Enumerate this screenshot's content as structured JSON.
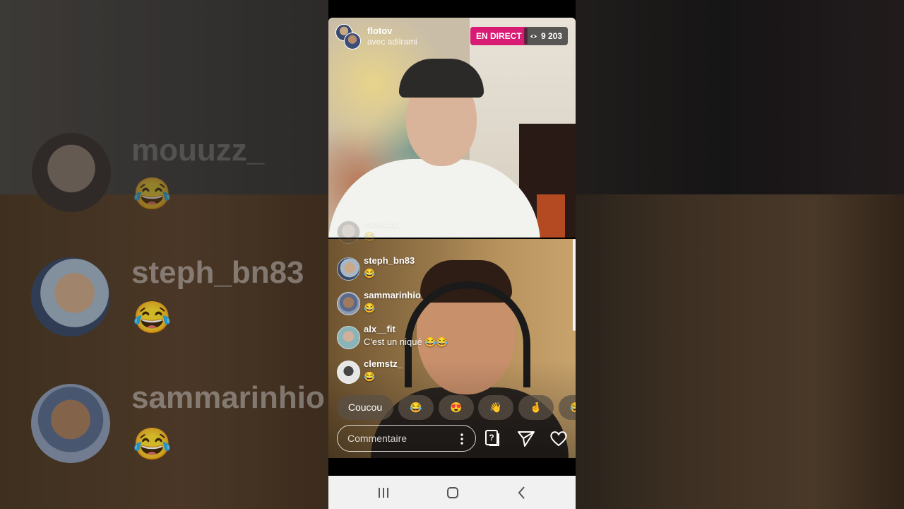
{
  "background": {
    "names": [
      "mouuzz_",
      "steph_bn83",
      "sammarinhio"
    ],
    "emojis": [
      "😂",
      "😂",
      "😂"
    ]
  },
  "live": {
    "host": "flotov",
    "with": "avec adilrami",
    "badge": "EN DIRECT",
    "viewers": "9 203"
  },
  "comments": [
    {
      "user": "mouuzz_",
      "text": "😂"
    },
    {
      "user": "steph_bn83",
      "text": "😂"
    },
    {
      "user": "sammarinhio",
      "text": "😂"
    },
    {
      "user": "alx__fit",
      "text": "C'est un niqué 😂😂"
    },
    {
      "user": "clemstz_",
      "text": "😂"
    }
  ],
  "quick_reactions": [
    "Coucou",
    "😂",
    "😍",
    "👋",
    "🤞",
    "😂"
  ],
  "composer": {
    "placeholder": "Commentaire"
  },
  "icons": {
    "eye": "eye-icon",
    "more": "more-vertical-icon",
    "question": "question-icon",
    "share": "send-icon",
    "like": "heart-icon",
    "recents": "recents-icon",
    "home": "home-icon",
    "back": "back-icon"
  },
  "colors": {
    "live_badge": "#d81b73",
    "navbar": "#f1f1f1"
  }
}
